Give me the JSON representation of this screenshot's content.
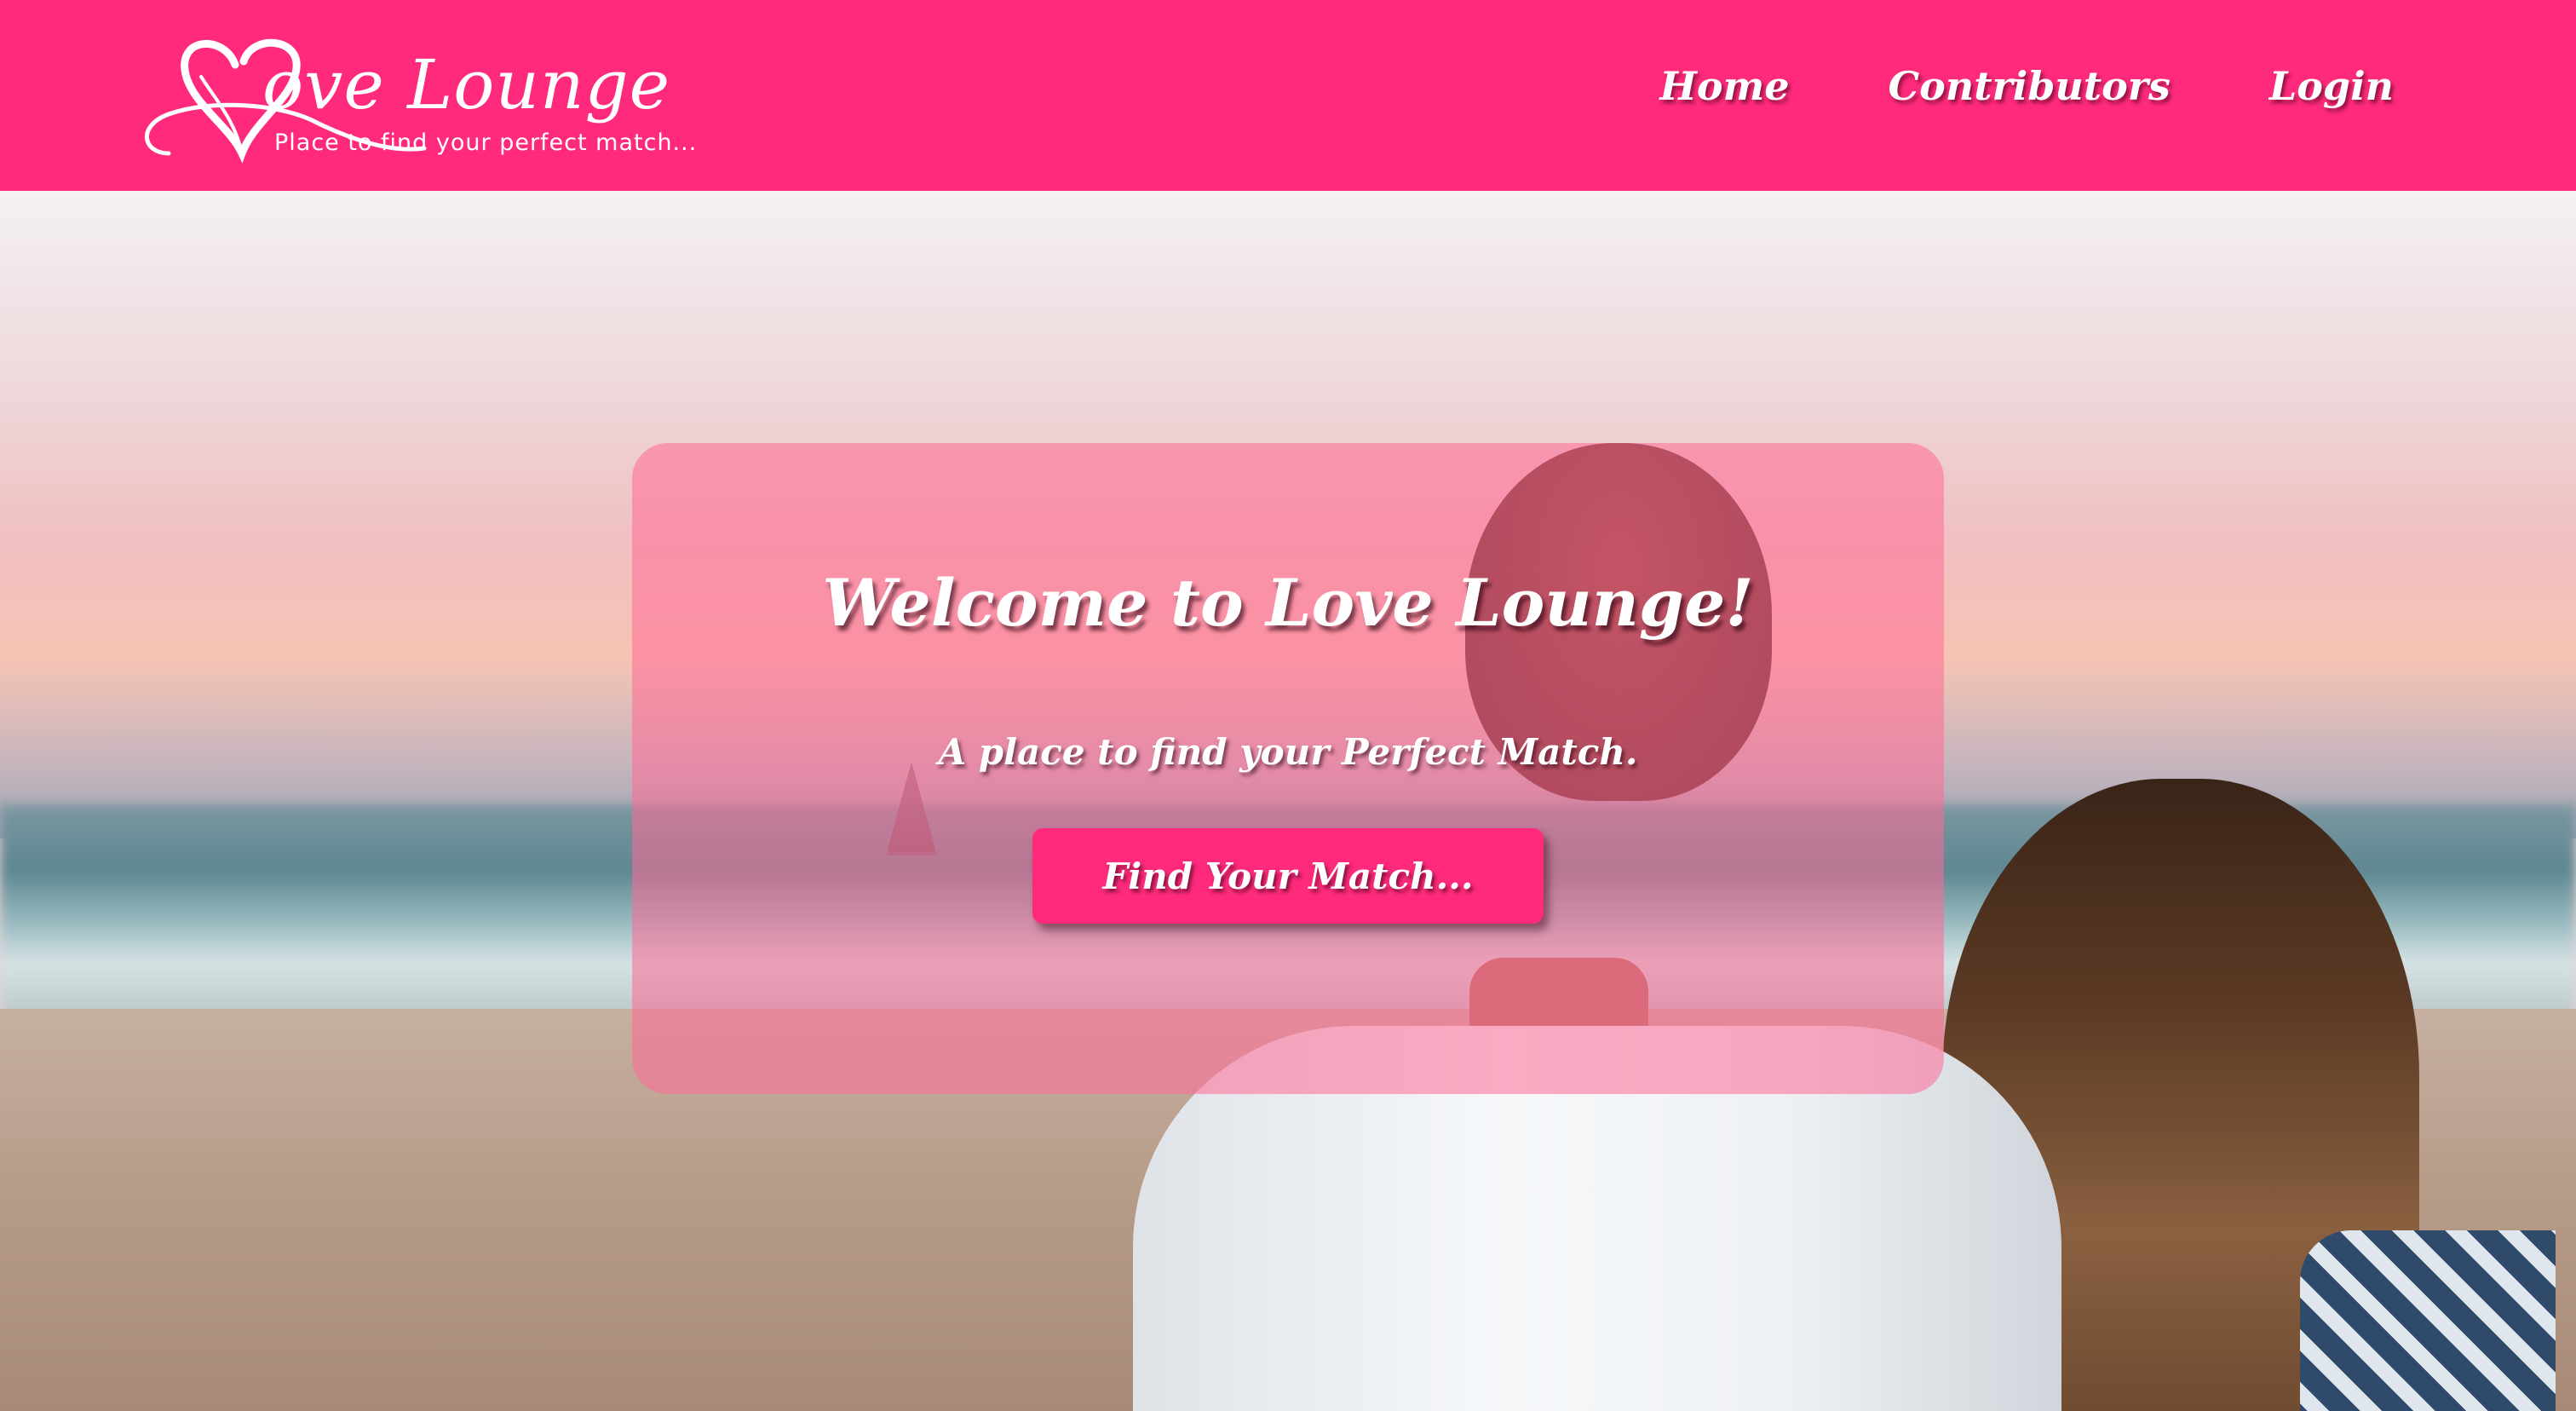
{
  "brand": {
    "name": "Love Lounge",
    "logo_word": "ove Lounge",
    "tagline": "Place to find your perfect match..."
  },
  "nav": {
    "items": [
      {
        "label": "Home"
      },
      {
        "label": "Contributors"
      },
      {
        "label": "Login"
      }
    ]
  },
  "hero": {
    "title": "Welcome to Love Lounge!",
    "subtitle": "A place to find your Perfect Match.",
    "cta_label": "Find Your Match..."
  },
  "colors": {
    "primary": "#ff2a7c",
    "card_overlay": "rgba(255, 105, 150, 0.55)",
    "text": "#ffffff"
  },
  "icons": {
    "logo_heart": "heart-icon"
  }
}
